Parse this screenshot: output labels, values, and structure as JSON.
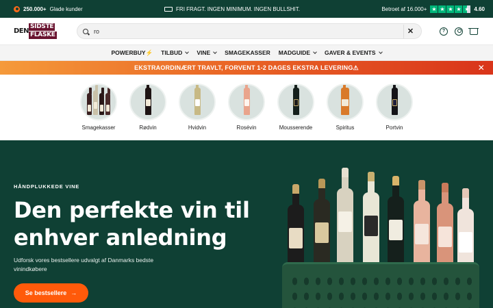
{
  "topbar": {
    "customers_count": "250.000+",
    "customers_text": "Glade kunder",
    "shipping": "FRI FRAGT. INGEN MINIMUM. INGEN BULLSHIT.",
    "rating_prefix": "Betroet af 16.000+",
    "rating_value": "4.60",
    "stars": 4.6
  },
  "header": {
    "logo_top": "SIDSTE",
    "logo_left": "DEN",
    "logo_bottom": "FLASKE",
    "search_value": "ro",
    "clear_label": "✕",
    "help_label": "?"
  },
  "nav": {
    "items": [
      {
        "label": "POWERBUY⚡",
        "dropdown": false
      },
      {
        "label": "TILBUD",
        "dropdown": true
      },
      {
        "label": "VINE",
        "dropdown": true
      },
      {
        "label": "SMAGEKASSER",
        "dropdown": false
      },
      {
        "label": "MADGUIDE",
        "dropdown": true
      },
      {
        "label": "GAVER & EVENTS",
        "dropdown": true
      }
    ]
  },
  "alert": {
    "text": "EKSTRAORDINÆRT TRAVLT, FORVENT 1-2 DAGES EKSTRA LEVERING⚠",
    "close_label": "✕"
  },
  "categories": [
    {
      "label": "Smagekasser"
    },
    {
      "label": "Rødvin"
    },
    {
      "label": "Hvidvin"
    },
    {
      "label": "Rosévin"
    },
    {
      "label": "Mousserende"
    },
    {
      "label": "Spiritus"
    },
    {
      "label": "Portvin"
    }
  ],
  "hero": {
    "eyebrow": "HÅNDPLUKKEDE VINE",
    "headline": "Den perfekte vin til enhver anledning",
    "subtext": "Udforsk vores bestsellere  udvalgt af Danmarks bedste vinindkøbere",
    "cta_label": "Se bestsellere",
    "cta_arrow": "→"
  },
  "colors": {
    "brand_green": "#0f4034",
    "cta_orange": "#ff5a0a",
    "trustpilot_green": "#00b67a",
    "logo_maroon": "#6a1430"
  }
}
